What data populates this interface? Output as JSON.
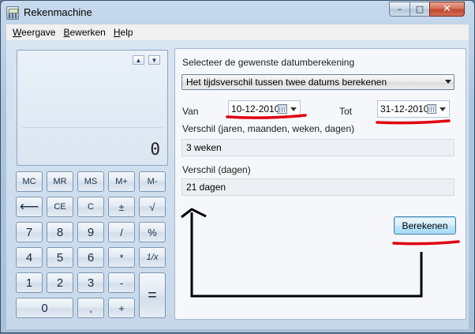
{
  "window": {
    "title": "Rekenmachine",
    "min": "–",
    "max": "□",
    "close": "✕"
  },
  "menu": [
    {
      "u": "W",
      "rest": "eergave"
    },
    {
      "u": "B",
      "rest": "ewerken"
    },
    {
      "u": "H",
      "rest": "elp"
    }
  ],
  "display": {
    "value": "0",
    "up": "▲",
    "down": "▼"
  },
  "keys": {
    "mc": "MC",
    "mr": "MR",
    "ms": "MS",
    "mplus": "M+",
    "mminus": "M-",
    "back": "⟵",
    "ce": "CE",
    "c": "C",
    "plusminus": "±",
    "sqrt": "√",
    "n7": "7",
    "n8": "8",
    "n9": "9",
    "div": "/",
    "pct": "%",
    "n4": "4",
    "n5": "5",
    "n6": "6",
    "mul": "*",
    "recip": "1/x",
    "n1": "1",
    "n2": "2",
    "n3": "3",
    "sub": "-",
    "eq": "=",
    "n0": "0",
    "dot": ",",
    "add": "+"
  },
  "panel": {
    "title": "Selecteer de gewenste datumberekening",
    "calc_type": "Het tijdsverschil tussen twee datums berekenen",
    "from_label": "Van",
    "from_value": "10-12-2010",
    "to_label": "Tot",
    "to_value": "31-12-2010",
    "diff_label": "Verschil (jaren, maanden, weken, dagen)",
    "diff_value": "3 weken",
    "days_label": "Verschil (dagen)",
    "days_value": "21 dagen",
    "button": "Berekenen"
  },
  "annotation_color": "#e00010"
}
